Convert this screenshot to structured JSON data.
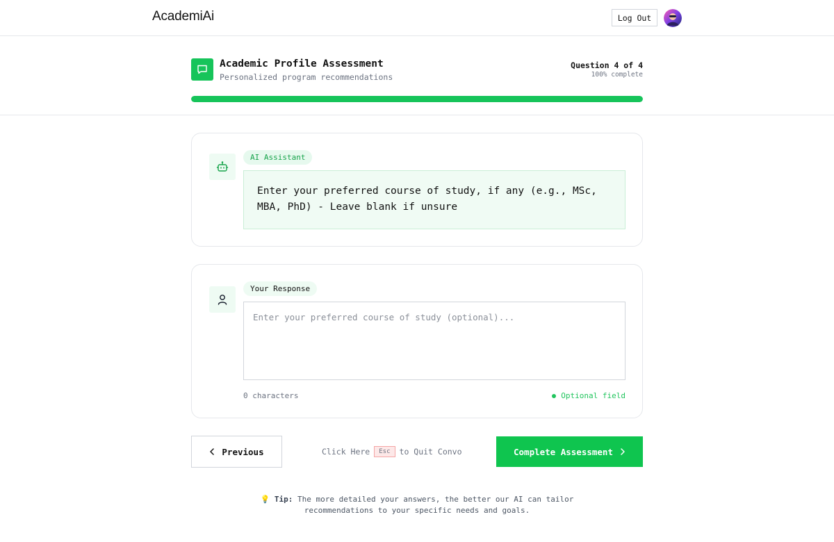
{
  "navbar": {
    "brand": "AcademiAi",
    "logout_label": "Log Out",
    "avatar_icon": "user-avatar"
  },
  "header": {
    "icon": "chat-bubble-icon",
    "title": "Academic Profile Assessment",
    "subtitle": "Personalized program recommendations",
    "question_count": "Question 4 of 4",
    "complete_text": "100% complete",
    "progress_percent": 100
  },
  "ai_card": {
    "icon": "robot-icon",
    "badge": "AI Assistant",
    "message": "Enter your preferred course of study, if any (e.g., MSc, MBA, PhD) - Leave blank if unsure"
  },
  "response_card": {
    "icon": "user-icon",
    "badge": "Your Response",
    "input_value": "",
    "input_placeholder": "Enter your preferred course of study (optional)...",
    "char_count": "0 characters",
    "optional_label": "Optional field"
  },
  "actions": {
    "previous_label": "Previous",
    "quit_prefix": "Click Here",
    "esc_key": "Esc",
    "quit_suffix": "to Quit Convo",
    "complete_label": "Complete Assessment"
  },
  "tip": {
    "icon": "lightbulb-icon",
    "label": "Tip:",
    "text": "The more detailed your answers, the better our AI can tailor recommendations to your specific needs and goals."
  },
  "colors": {
    "accent": "#16c45a",
    "accent_light": "#f0fbf4",
    "border": "#e5e7eb"
  }
}
